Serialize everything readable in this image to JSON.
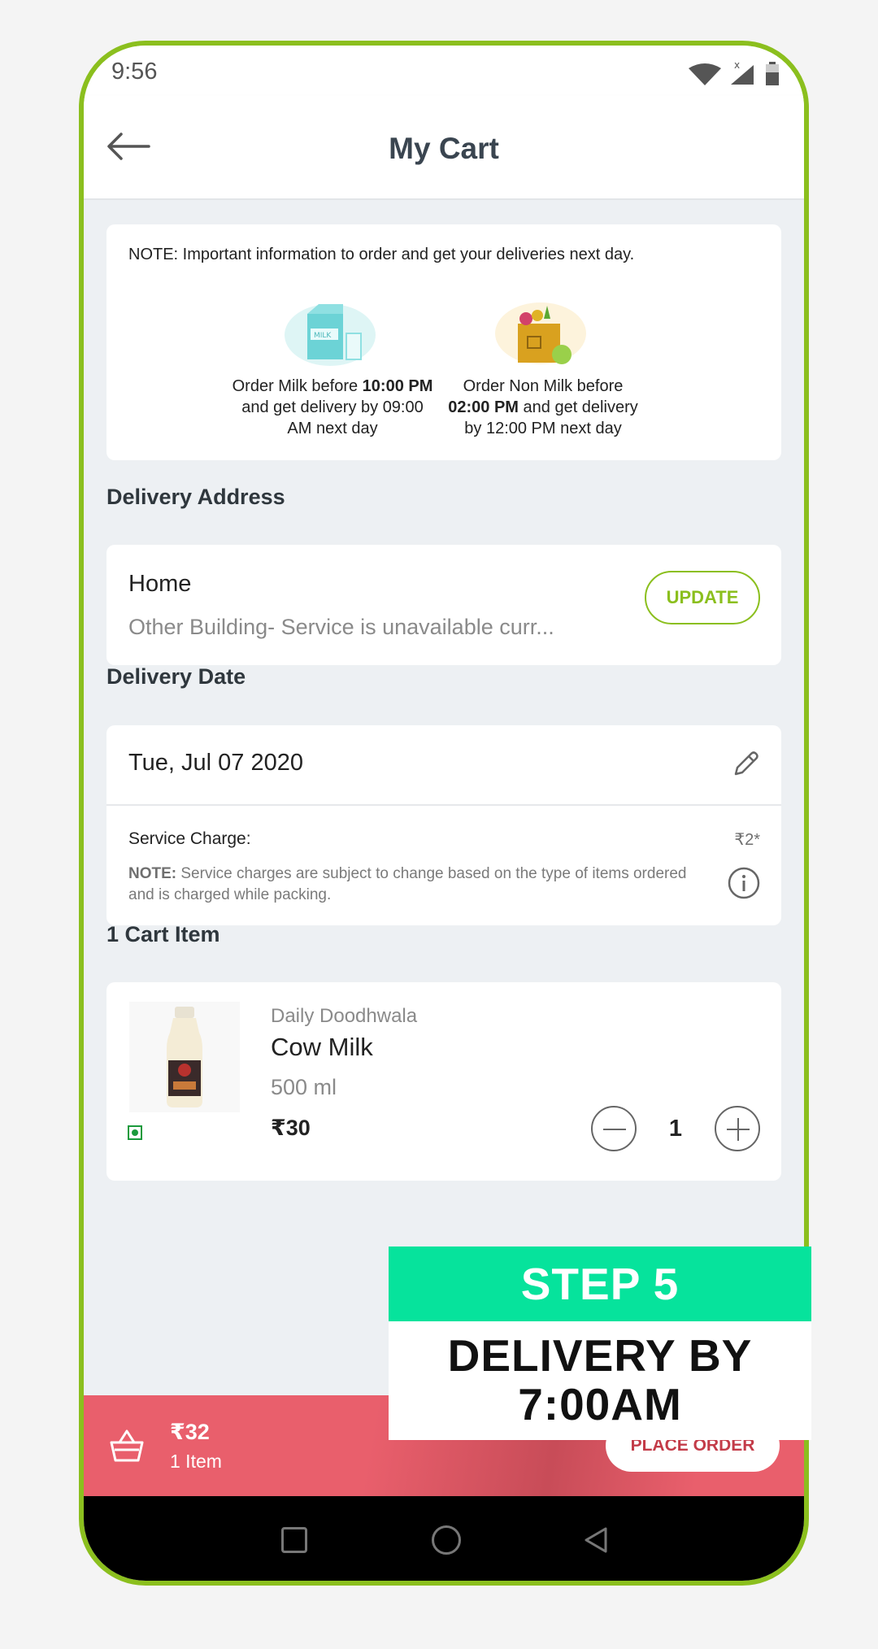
{
  "status_bar": {
    "time": "9:56"
  },
  "header": {
    "title": "My Cart"
  },
  "note": {
    "text": "NOTE: Important information to order and get your deliveries next day.",
    "milk": {
      "illustration_label": "MILK",
      "prefix": "Order Milk before ",
      "time": "10:00 PM",
      "suffix": " and get delivery by 09:00 AM next day"
    },
    "non_milk": {
      "prefix": "Order Non Milk before ",
      "time": "02:00 PM",
      "suffix": " and get delivery by 12:00 PM next day"
    }
  },
  "delivery_address": {
    "section_title": "Delivery Address",
    "name": "Home",
    "line": "Other Building- Service is unavailable curr...",
    "update_label": "UPDATE"
  },
  "delivery_date": {
    "section_title": "Delivery Date",
    "date": "Tue, Jul 07 2020",
    "service_charge_label": "Service Charge:",
    "service_charge_value": "₹2*",
    "note_label": "NOTE:",
    "note_text": " Service charges are subject to change based on the type of items ordered and is charged while packing."
  },
  "cart": {
    "section_title": "1 Cart Item",
    "item": {
      "brand": "Daily Doodhwala",
      "name": "Cow Milk",
      "quantity": "500 ml",
      "price": "₹30",
      "count": "1"
    }
  },
  "bottom_bar": {
    "total": "₹32",
    "items": "1 Item",
    "place_order_label": "PLACE ORDER"
  },
  "overlay": {
    "step": "STEP 5",
    "line1": "DELIVERY BY",
    "line2": "7:00AM"
  },
  "colors": {
    "frame_green": "#8bbf1e",
    "accent_green": "#8bbf1e",
    "bottom_bar_red": "#e95f6c",
    "step_green": "#06e39c"
  }
}
